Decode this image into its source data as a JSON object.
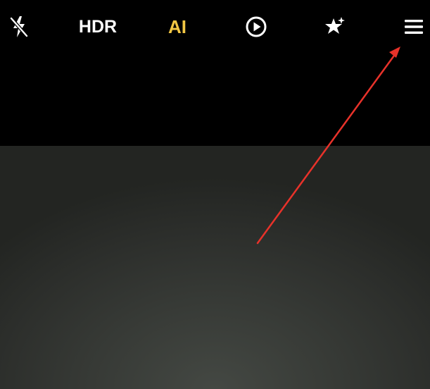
{
  "toolbar": {
    "flash": {
      "icon": "flash-off-icon",
      "state": "off"
    },
    "hdr": {
      "label": "HDR"
    },
    "ai": {
      "label": "AI",
      "active_color": "#f2c744"
    },
    "live_photo": {
      "icon": "live-photo-play-icon"
    },
    "filter": {
      "icon": "sparkle-star-icon"
    },
    "menu": {
      "icon": "hamburger-menu-icon"
    }
  },
  "annotation": {
    "arrow_color": "#e8322a",
    "points_to": "menu-button"
  },
  "colors": {
    "background": "#000000",
    "icon": "#ffffff",
    "ai_accent": "#f2c744",
    "viewfinder": "#2e302d"
  }
}
